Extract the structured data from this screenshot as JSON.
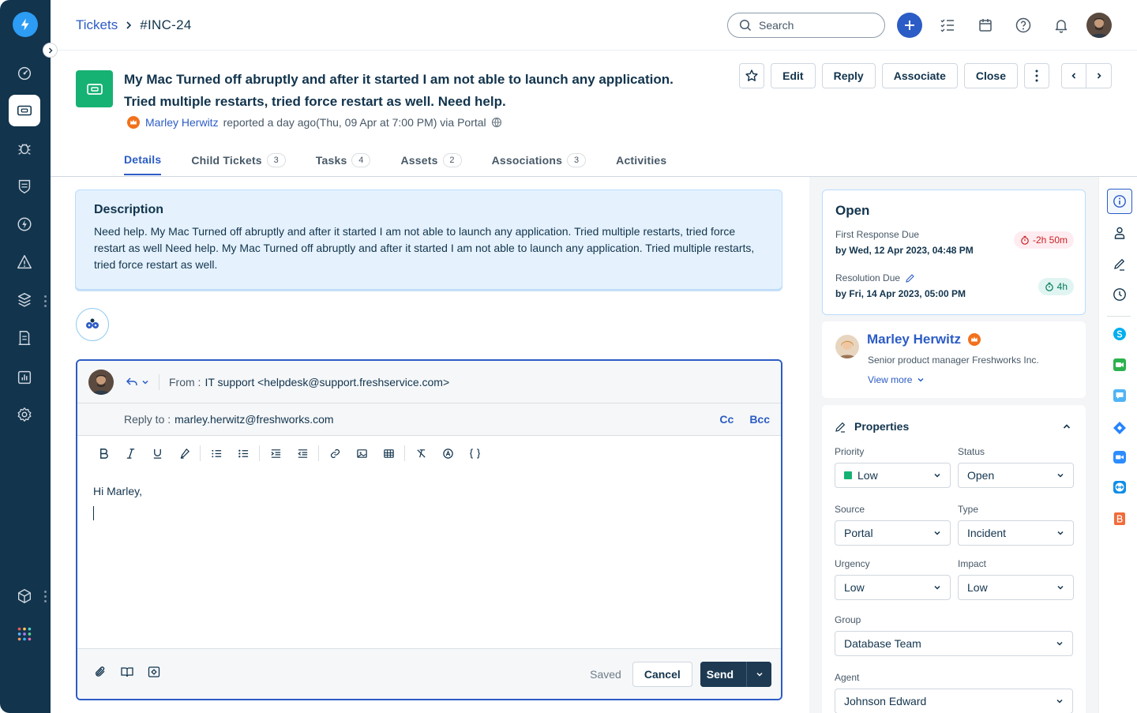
{
  "breadcrumb": {
    "parent": "Tickets",
    "separator": ">",
    "current": "#INC-24"
  },
  "search": {
    "placeholder": "Search"
  },
  "ticket": {
    "title_line1": "My Mac Turned off abruptly and after it started I am not able to launch any application.",
    "title_line2": "Tried multiple restarts, tried force restart as well. Need help.",
    "requester": "Marley Herwitz",
    "meta_text": "reported a day ago(Thu, 09 Apr at 7:00 PM) via Portal"
  },
  "actions": {
    "edit": "Edit",
    "reply": "Reply",
    "associate": "Associate",
    "close": "Close"
  },
  "tabs": [
    {
      "label": "Details",
      "count": ""
    },
    {
      "label": "Child Tickets",
      "count": "3"
    },
    {
      "label": "Tasks",
      "count": "4"
    },
    {
      "label": "Assets",
      "count": "2"
    },
    {
      "label": "Associations",
      "count": "3"
    },
    {
      "label": "Activities",
      "count": ""
    }
  ],
  "description": {
    "heading": "Description",
    "text": "Need help. My Mac Turned off abruptly and after it started I am not able to launch any application. Tried multiple restarts, tried force restart as well Need help. My Mac Turned off abruptly and after it started I am not able to launch any application. Tried multiple restarts, tried force restart as well."
  },
  "reply_editor": {
    "from_label": "From :",
    "from_value": "IT support <helpdesk@support.freshservice.com>",
    "replyto_label": "Reply to :",
    "replyto_value": "marley.herwitz@freshworks.com",
    "cc": "Cc",
    "bcc": "Bcc",
    "body_greeting": "Hi Marley,",
    "saved": "Saved",
    "cancel": "Cancel",
    "send": "Send"
  },
  "status": {
    "title": "Open",
    "first_response_label": "First Response Due",
    "first_response_value": "by Wed, 12 Apr 2023, 04:48 PM",
    "first_response_chip": "-2h 50m",
    "resolution_label": "Resolution Due",
    "resolution_value": "by Fri, 14 Apr 2023, 05:00 PM",
    "resolution_chip": "4h"
  },
  "requester_card": {
    "name": "Marley Herwitz",
    "title": "Senior product manager Freshworks Inc.",
    "view_more": "View more"
  },
  "properties": {
    "heading": "Properties",
    "priority_label": "Priority",
    "priority": "Low",
    "status_label": "Status",
    "status": "Open",
    "source_label": "Source",
    "source": "Portal",
    "type_label": "Type",
    "type": "Incident",
    "urgency_label": "Urgency",
    "urgency": "Low",
    "impact_label": "Impact",
    "impact": "Low",
    "group_label": "Group",
    "group": "Database Team",
    "agent_label": "Agent",
    "agent": "Johnson Edward"
  },
  "colors": {
    "nav": "#12344d",
    "accent": "#2c5cc5",
    "ticket_icon": "#16b273",
    "priority_low": "#16b273",
    "overdue": "#c82124",
    "on_time": "#00795b"
  }
}
